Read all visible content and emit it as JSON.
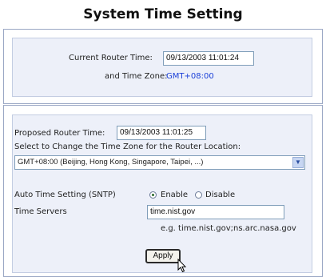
{
  "page": {
    "title": "System Time Setting"
  },
  "current": {
    "router_time_label": "Current Router Time:",
    "router_time_value": "09/13/2003 11:01:24",
    "time_zone_label": "and Time Zone:",
    "time_zone_value": "GMT+08:00"
  },
  "proposed": {
    "router_time_label": "Proposed Router Time:",
    "router_time_value": "09/13/2003 11:01:25",
    "select_zone_label": "Select to Change the Time Zone for the Router Location:",
    "time_zone_selected": "GMT+08:00 (Beijing, Hong Kong, Singapore, Taipei, ...)",
    "sntp_label": "Auto Time Setting (SNTP)",
    "enable_label": "Enable",
    "disable_label": "Disable",
    "sntp_enabled": true,
    "time_servers_label": "Time Servers",
    "time_servers_value": "time.nist.gov",
    "time_servers_hint": "e.g. time.nist.gov;ns.arc.nasa.gov",
    "apply_label": "Apply"
  },
  "colors": {
    "panel_bg": "#edf0f9",
    "accent_blue": "#1a3fd8"
  }
}
